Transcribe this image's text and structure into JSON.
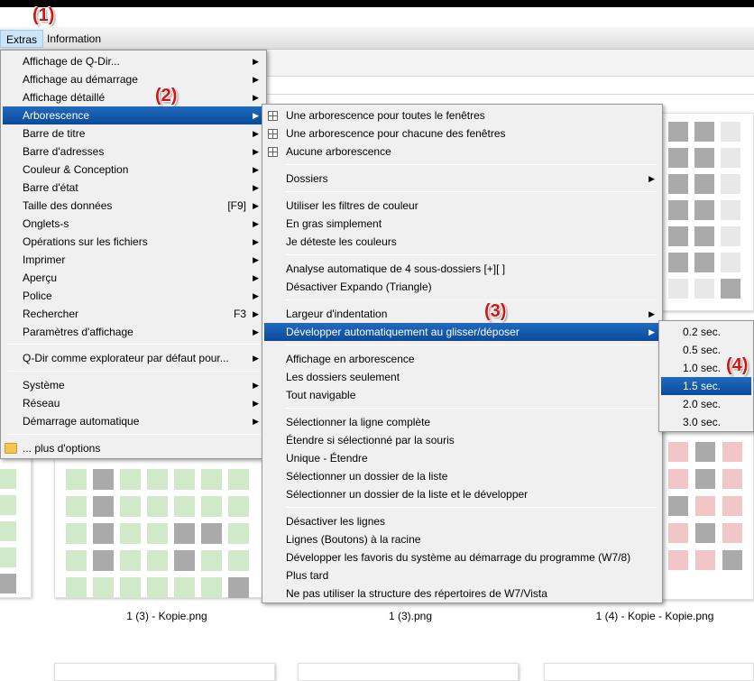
{
  "menubar": {
    "extras": "Extras",
    "information": "Information"
  },
  "steps": {
    "s1": "(1)",
    "s2": "(2)",
    "s3": "(3)",
    "s4": "(4)"
  },
  "extras_menu": [
    {
      "label": "Affichage de Q-Dir...",
      "arrow": true
    },
    {
      "label": "Affichage au démarrage",
      "arrow": true
    },
    {
      "label": "Affichage détaillé",
      "arrow": true
    },
    {
      "label": "Arborescence",
      "arrow": true,
      "highlighted": true
    },
    {
      "label": "Barre de titre",
      "arrow": true
    },
    {
      "label": "Barre d'adresses",
      "arrow": true
    },
    {
      "label": "Couleur & Conception",
      "arrow": true
    },
    {
      "label": "Barre d'état",
      "arrow": true
    },
    {
      "label": "Taille des données",
      "shortcut": "[F9]",
      "arrow": true
    },
    {
      "label": "Onglets-s",
      "arrow": true
    },
    {
      "label": "Opérations sur les fichiers",
      "arrow": true
    },
    {
      "label": "Imprimer",
      "arrow": true
    },
    {
      "label": "Aperçu",
      "arrow": true
    },
    {
      "label": "Police",
      "arrow": true
    },
    {
      "label": "Rechercher",
      "shortcut": "F3",
      "arrow": true
    },
    {
      "label": "Paramètres d'affichage",
      "arrow": true
    },
    {
      "label": "Q-Dir comme explorateur par défaut pour...",
      "arrow": true
    },
    {
      "label": "Système",
      "arrow": true
    },
    {
      "label": "Réseau",
      "arrow": true
    },
    {
      "label": "Démarrage automatique",
      "arrow": true
    },
    {
      "label": "... plus d'options",
      "icon": "folder-icon"
    }
  ],
  "tree_menu": [
    {
      "label": "Une arborescence pour toutes le fenêtres",
      "icon": "tree-grid-icon"
    },
    {
      "label": "Une arborescence pour chacune des fenêtres",
      "icon": "tree-grid-icon"
    },
    {
      "label": "Aucune arborescence",
      "icon": "tree-grid-icon"
    },
    {
      "label": "Dossiers",
      "arrow": true
    },
    {
      "label": "Utiliser les filtres de couleur"
    },
    {
      "label": "En gras simplement"
    },
    {
      "label": "Je déteste les couleurs"
    },
    {
      "label": "Analyse automatique de 4 sous-dossiers [+][ ]"
    },
    {
      "label": "Désactiver Expando (Triangle)"
    },
    {
      "label": "Largeur d'indentation",
      "arrow": true
    },
    {
      "label": "Développer automatiquement au glisser/déposer",
      "arrow": true,
      "highlighted": true
    },
    {
      "label": "Affichage en arborescence"
    },
    {
      "label": "Les dossiers seulement"
    },
    {
      "label": "Tout navigable"
    },
    {
      "label": "Sélectionner la ligne complète"
    },
    {
      "label": "Étendre si sélectionné par la souris"
    },
    {
      "label": "Unique - Étendre"
    },
    {
      "label": "Sélectionner un dossier de la liste"
    },
    {
      "label": "Sélectionner un dossier de la liste et le développer"
    },
    {
      "label": "Désactiver les lignes"
    },
    {
      "label": "Lignes (Boutons) à la racine"
    },
    {
      "label": "Développer les favoris du système au démarrage du programme (W7/8)"
    },
    {
      "label": "Plus tard"
    },
    {
      "label": "Ne pas utiliser la structure des répertoires de W7/Vista"
    }
  ],
  "delay_menu": [
    {
      "label": "0.2 sec."
    },
    {
      "label": "0.5 sec."
    },
    {
      "label": "1.0 sec."
    },
    {
      "label": "1.5 sec.",
      "highlighted": true
    },
    {
      "label": "2.0 sec."
    },
    {
      "label": "3.0 sec."
    }
  ],
  "thumbnails": {
    "captions": [
      "1 (3) - Kopie.png",
      "1 (3).png",
      "1 (4) - Kopie - Kopie.png"
    ]
  },
  "colors": {
    "highlight": "#0c4a9a",
    "green_cell": "#cfe9c9",
    "gray_cell": "#aaaaaa",
    "pink_cell": "#f2c6c6",
    "step_red": "#d41414"
  }
}
